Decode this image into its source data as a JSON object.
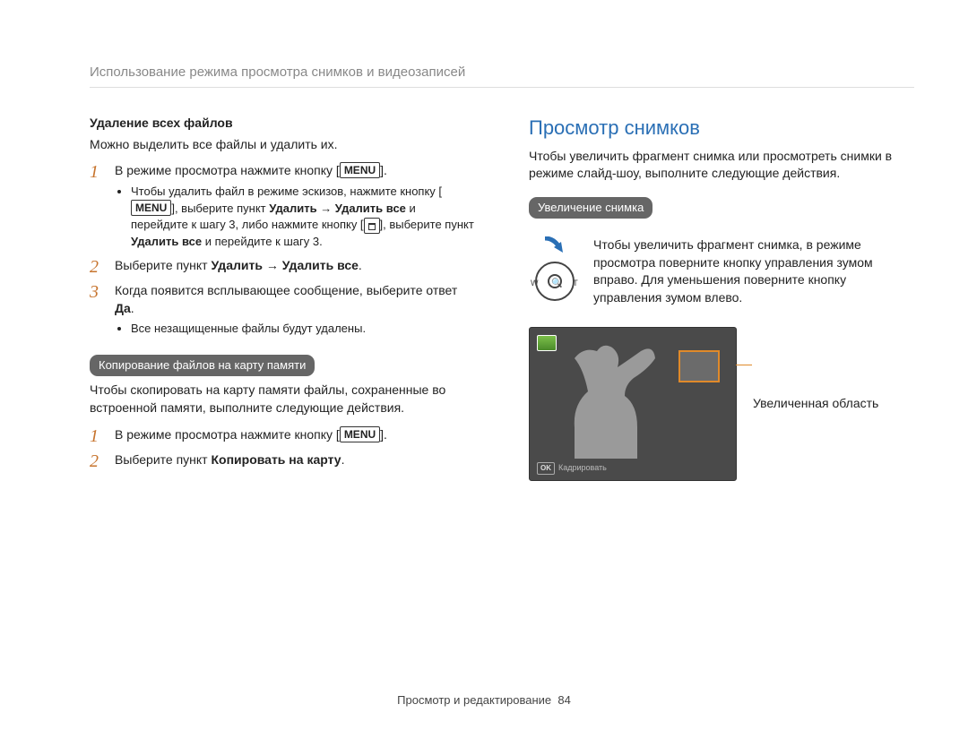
{
  "topline": "Использование режима просмотра снимков и видеозаписей",
  "left": {
    "delete_heading": "Удаление всех файлов",
    "delete_intro": "Можно выделить все файлы и удалить их.",
    "steps1": {
      "n1": "1",
      "t1a": "В режиме просмотра нажмите кнопку [",
      "menu": "MENU",
      "t1b": "].",
      "b1a": "Чтобы удалить файл в режиме эскизов, нажмите кнопку [",
      "b1b": "], выберите пункт ",
      "b1c": "Удалить → Удалить все",
      "b1d": " и перейдите к шагу 3, либо нажмите кнопку [",
      "b1e": "], выберите пункт ",
      "b1f": "Удалить все",
      "b1g": " и перейдите к шагу 3.",
      "n2": "2",
      "t2a": "Выберите пункт ",
      "t2b": "Удалить → Удалить все",
      "t2c": ".",
      "n3": "3",
      "t3a": "Когда появится всплывающее сообщение, выберите ответ ",
      "t3b": "Да",
      "t3c": ".",
      "b3": "Все незащищенные файлы будут удалены."
    },
    "copy_pill": "Копирование файлов на карту памяти",
    "copy_intro": "Чтобы скопировать на карту памяти файлы, сохраненные во встроенной памяти, выполните следующие действия.",
    "steps2": {
      "n1": "1",
      "t1a": "В режиме просмотра нажмите кнопку [",
      "menu": "MENU",
      "t1b": "].",
      "n2": "2",
      "t2a": "Выберите пункт ",
      "t2b": "Копировать на карту",
      "t2c": "."
    }
  },
  "right": {
    "title": "Просмотр снимков",
    "intro": "Чтобы увеличить фрагмент снимка или просмотреть снимки в режиме слайд-шоу, выполните следующие действия.",
    "zoom_pill": "Увеличение снимка",
    "zoom_text": "Чтобы увеличить фрагмент снимка, в режиме просмотра поверните кнопку управления зумом вправо. Для уменьшения поверните кнопку управления зумом влево.",
    "dial_w": "W",
    "dial_t": "T",
    "mag_icon": "🔍",
    "enlarged_label": "Увеличенная область",
    "ok_label": "OK",
    "crop_label": "Кадрировать"
  },
  "footer": {
    "section": "Просмотр и редактирование",
    "page": "84"
  }
}
